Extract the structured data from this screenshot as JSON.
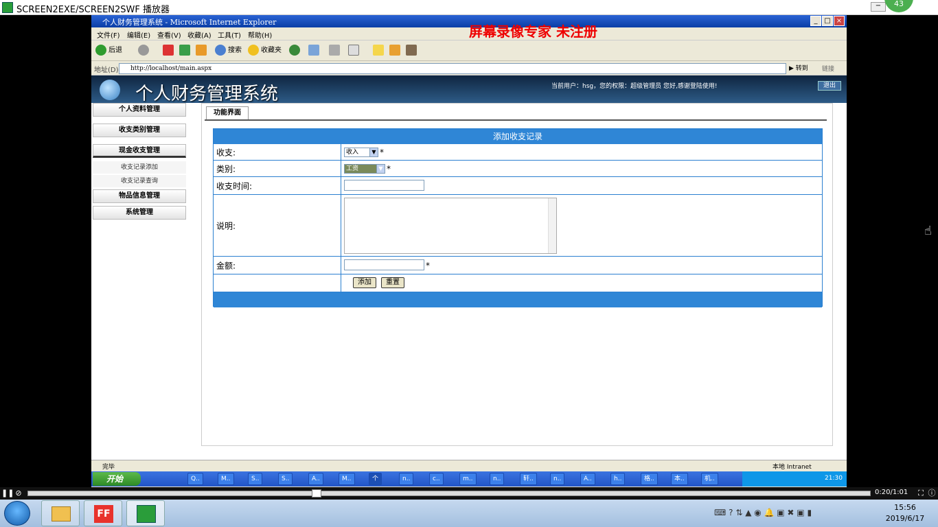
{
  "player_window": {
    "title": "SCREEN2EXE/SCREEN2SWF 播放器",
    "badge": "43",
    "minimize": "−"
  },
  "ie": {
    "title": "个人财务管理系统 - Microsoft Internet Explorer",
    "watermark": "屏幕录像专家  未注册",
    "window_buttons": [
      "_",
      "□",
      "×"
    ],
    "menu": [
      "文件(F)",
      "编辑(E)",
      "查看(V)",
      "收藏(A)",
      "工具(T)",
      "帮助(H)"
    ],
    "toolbar": {
      "back": "后退",
      "search": "搜索",
      "favorites": "收藏夹"
    },
    "address": {
      "label": "地址(D)",
      "url": "http://localhost/main.aspx",
      "go": "转到",
      "links": "链接"
    },
    "status": {
      "left": "完毕",
      "zone": "本地 Intranet"
    }
  },
  "app": {
    "system_name": "个人财务管理系统",
    "user_info": "当前用户：hsg，您的权限：超级管理员 您好,感谢登陆使用!",
    "logout": "退出",
    "sidebar": {
      "items": [
        {
          "label": "个人资料管理"
        },
        {
          "label": "收支类别管理"
        },
        {
          "label": "现金收支管理"
        },
        {
          "label": "物品信息管理"
        },
        {
          "label": "系统管理"
        }
      ],
      "subitems": [
        {
          "label": "收支记录添加"
        },
        {
          "label": "收支记录查询"
        }
      ]
    },
    "tab": "功能界面",
    "form": {
      "header": "添加收支记录",
      "type_label": "收支:",
      "type_value": "收入",
      "category_label": "类别:",
      "category_value": "工资",
      "time_label": "收支时间:",
      "time_value": "",
      "desc_label": "说明:",
      "desc_value": "",
      "amount_label": "金额:",
      "amount_value": "",
      "required_mark": "*",
      "add_button": "添加",
      "reset_button": "重置"
    }
  },
  "xp_taskbar": {
    "start": "开始",
    "items": [
      "Q..",
      "M..",
      "S..",
      "S..",
      "A..",
      "M..",
      "个",
      "n..",
      "c..",
      "m..",
      "n..",
      "轩..",
      "n..",
      "A..",
      "h..",
      "格..",
      "本..",
      "机.."
    ],
    "time": "21:30"
  },
  "player": {
    "time": "0:20/1:01",
    "progress": 0.33
  },
  "win7": {
    "time": "15:56",
    "date": "2019/6/17"
  }
}
